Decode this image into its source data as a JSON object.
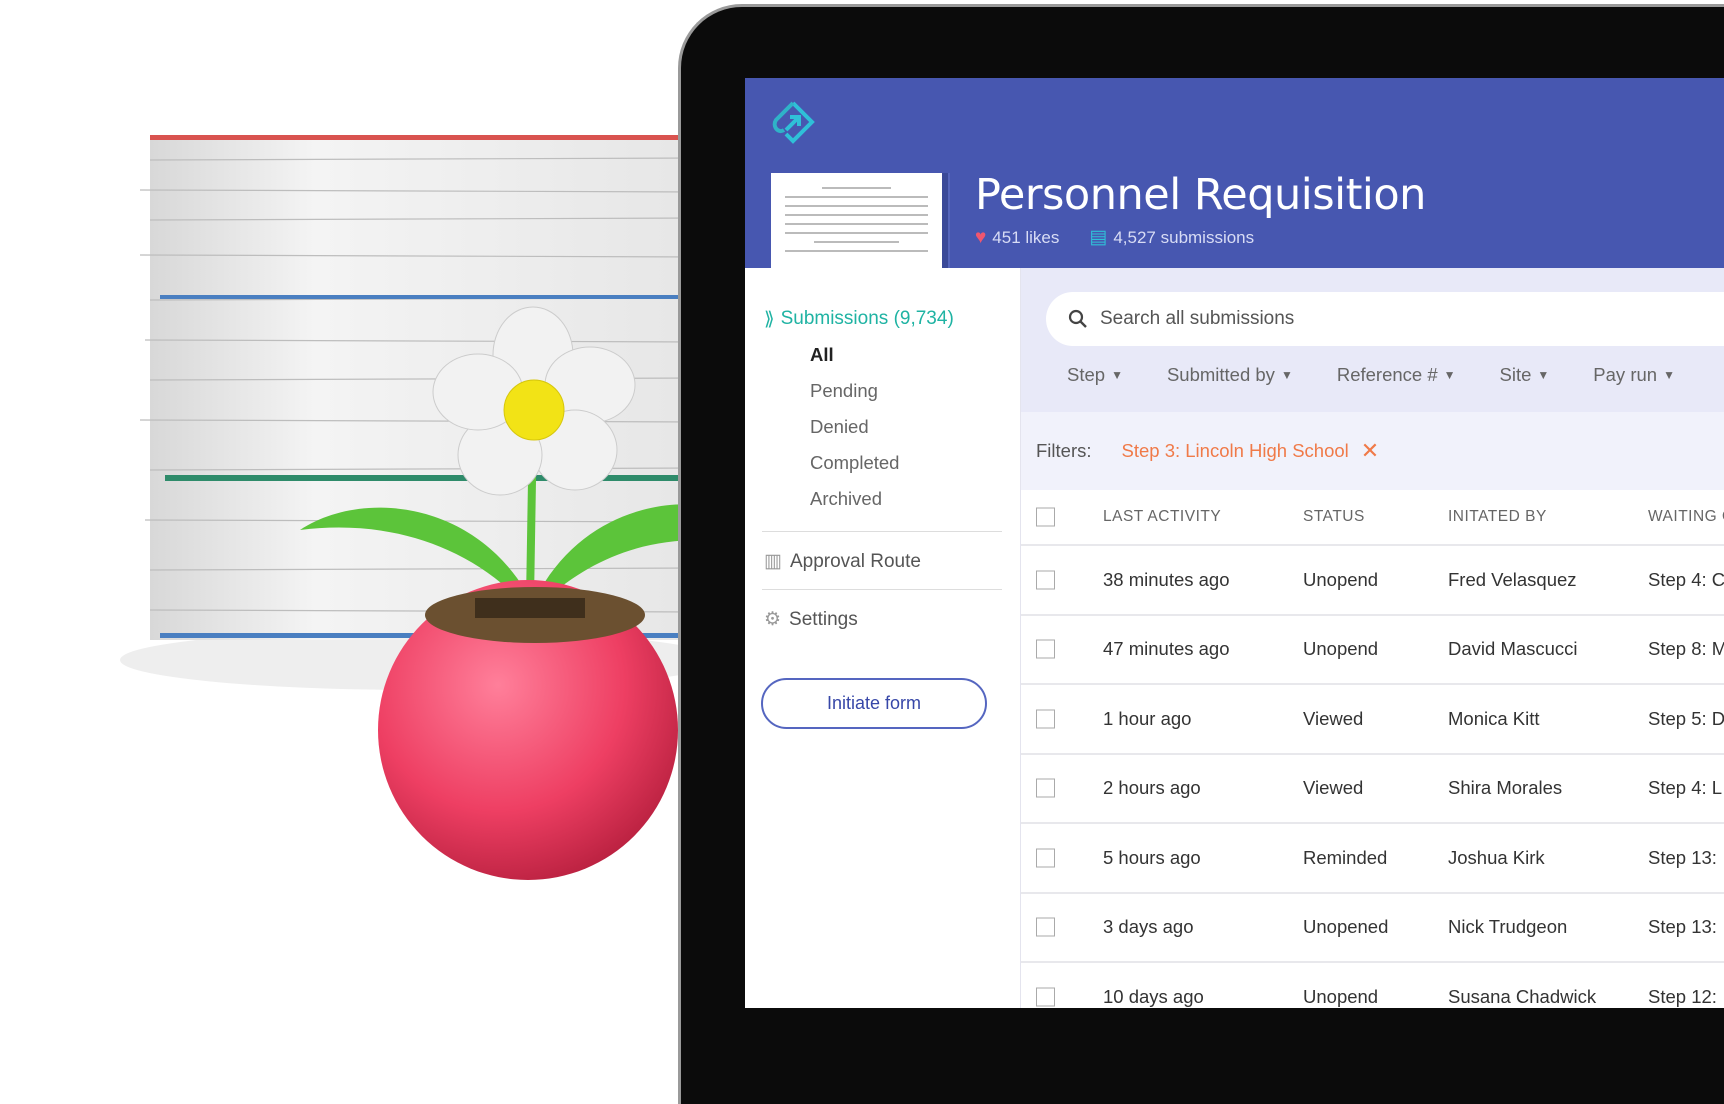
{
  "app": {
    "title": "Personnel Requisition",
    "likes": "451 likes",
    "submissions": "4,527 submissions",
    "colors": {
      "header": "#4757b0",
      "accent": "#1fb3a3",
      "filter": "#f07a48"
    }
  },
  "sidebar": {
    "section": "Submissions (9,734)",
    "items": [
      {
        "label": "All",
        "active": true
      },
      {
        "label": "Pending"
      },
      {
        "label": "Denied"
      },
      {
        "label": "Completed"
      },
      {
        "label": "Archived"
      }
    ],
    "approval": "Approval Route",
    "settings": "Settings",
    "initiate": "Initiate form"
  },
  "search": {
    "placeholder": "Search all submissions"
  },
  "dropdowns": [
    "Step",
    "Submitted by",
    "Reference #",
    "Site",
    "Pay run"
  ],
  "filters": {
    "label": "Filters:",
    "chip": "Step 3: Lincoln High School"
  },
  "table": {
    "headers": [
      "LAST ACTIVITY",
      "STATUS",
      "INITATED BY",
      "WAITING O"
    ],
    "rows": [
      [
        "38 minutes ago",
        "Unopend",
        "Fred Velasquez",
        "Step 4: C"
      ],
      [
        "47 minutes ago",
        "Unopend",
        "David Mascucci",
        "Step 8: M"
      ],
      [
        "1 hour ago",
        "Viewed",
        "Monica Kitt",
        "Step 5: D"
      ],
      [
        "2 hours ago",
        "Viewed",
        "Shira Morales",
        "Step 4: L"
      ],
      [
        "5 hours ago",
        "Reminded",
        "Joshua Kirk",
        "Step 13:"
      ],
      [
        "3 days ago",
        "Unopened",
        "Nick Trudgeon",
        "Step 13:"
      ],
      [
        "10 days ago",
        "Unopend",
        "Susana Chadwick",
        "Step 12:"
      ]
    ]
  }
}
